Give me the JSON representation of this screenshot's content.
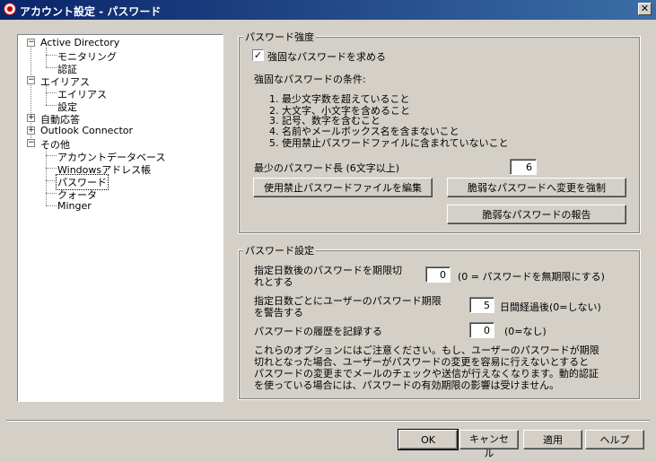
{
  "window": {
    "title": "アカウント設定 - パスワード",
    "close_symbol": "✕"
  },
  "tree": {
    "items": [
      {
        "label": "Active Directory",
        "expander": "−"
      },
      {
        "label": "モニタリング"
      },
      {
        "label": "認証"
      },
      {
        "label": "エイリアス",
        "expander": "−"
      },
      {
        "label": "エイリアス"
      },
      {
        "label": "設定"
      },
      {
        "label": "自動応答",
        "expander": "+"
      },
      {
        "label": "Outlook Connector",
        "expander": "+"
      },
      {
        "label": "その他",
        "expander": "−"
      },
      {
        "label": "アカウントデータベース"
      },
      {
        "label": "Windowsアドレス帳"
      },
      {
        "label": "パスワード",
        "selected": true
      },
      {
        "label": "クォータ"
      },
      {
        "label": "Minger"
      }
    ]
  },
  "strength": {
    "group_label": "パスワード強度",
    "require_strong_label": "強固なパスワードを求める",
    "require_strong_checked": true,
    "check_mark": "✓",
    "conditions_heading": "強固なパスワードの条件:",
    "conditions": [
      "1. 最少文字数を超えていること",
      "2. 大文字、小文字を含めること",
      "3. 記号、数字を含むこと",
      "4. 名前やメールボックス名を含まないこと",
      "5. 使用禁止パスワードファイルに含まれていないこと"
    ],
    "min_length_label": "最少のパスワード長 (6文字以上)",
    "min_length_value": "6",
    "edit_banned_button": "使用禁止パスワードファイルを編集",
    "force_change_button": "脆弱なパスワードへ変更を強制",
    "report_button": "脆弱なパスワードの報告"
  },
  "settings": {
    "group_label": "パスワード設定",
    "expire_label_1": "指定日数後のパスワードを期限切",
    "expire_label_2": "れとする",
    "expire_value": "0",
    "expire_hint": "(0 = パスワードを無期限にする)",
    "warn_label_1": "指定日数ごとにユーザーのパスワード期限",
    "warn_label_2": "を警告する",
    "warn_value": "5",
    "warn_hint": "日間経過後(0=しない)",
    "history_label": "パスワードの履歴を記録する",
    "history_value": "0",
    "history_hint": "(0=なし)",
    "note_lines": [
      "これらのオプションにはご注意ください。もし、ユーザーのパスワードが期限",
      "切れとなった場合、ユーザーがパスワードの変更を容易に行えないとすると",
      "パスワードの変更までメールのチェックや送信が行えなくなります。動的認証",
      "を使っている場合には、パスワードの有効期限の影響は受けません。"
    ]
  },
  "footer": {
    "ok": "OK",
    "cancel": "キャンセル",
    "apply": "適用",
    "help": "ヘルプ"
  }
}
